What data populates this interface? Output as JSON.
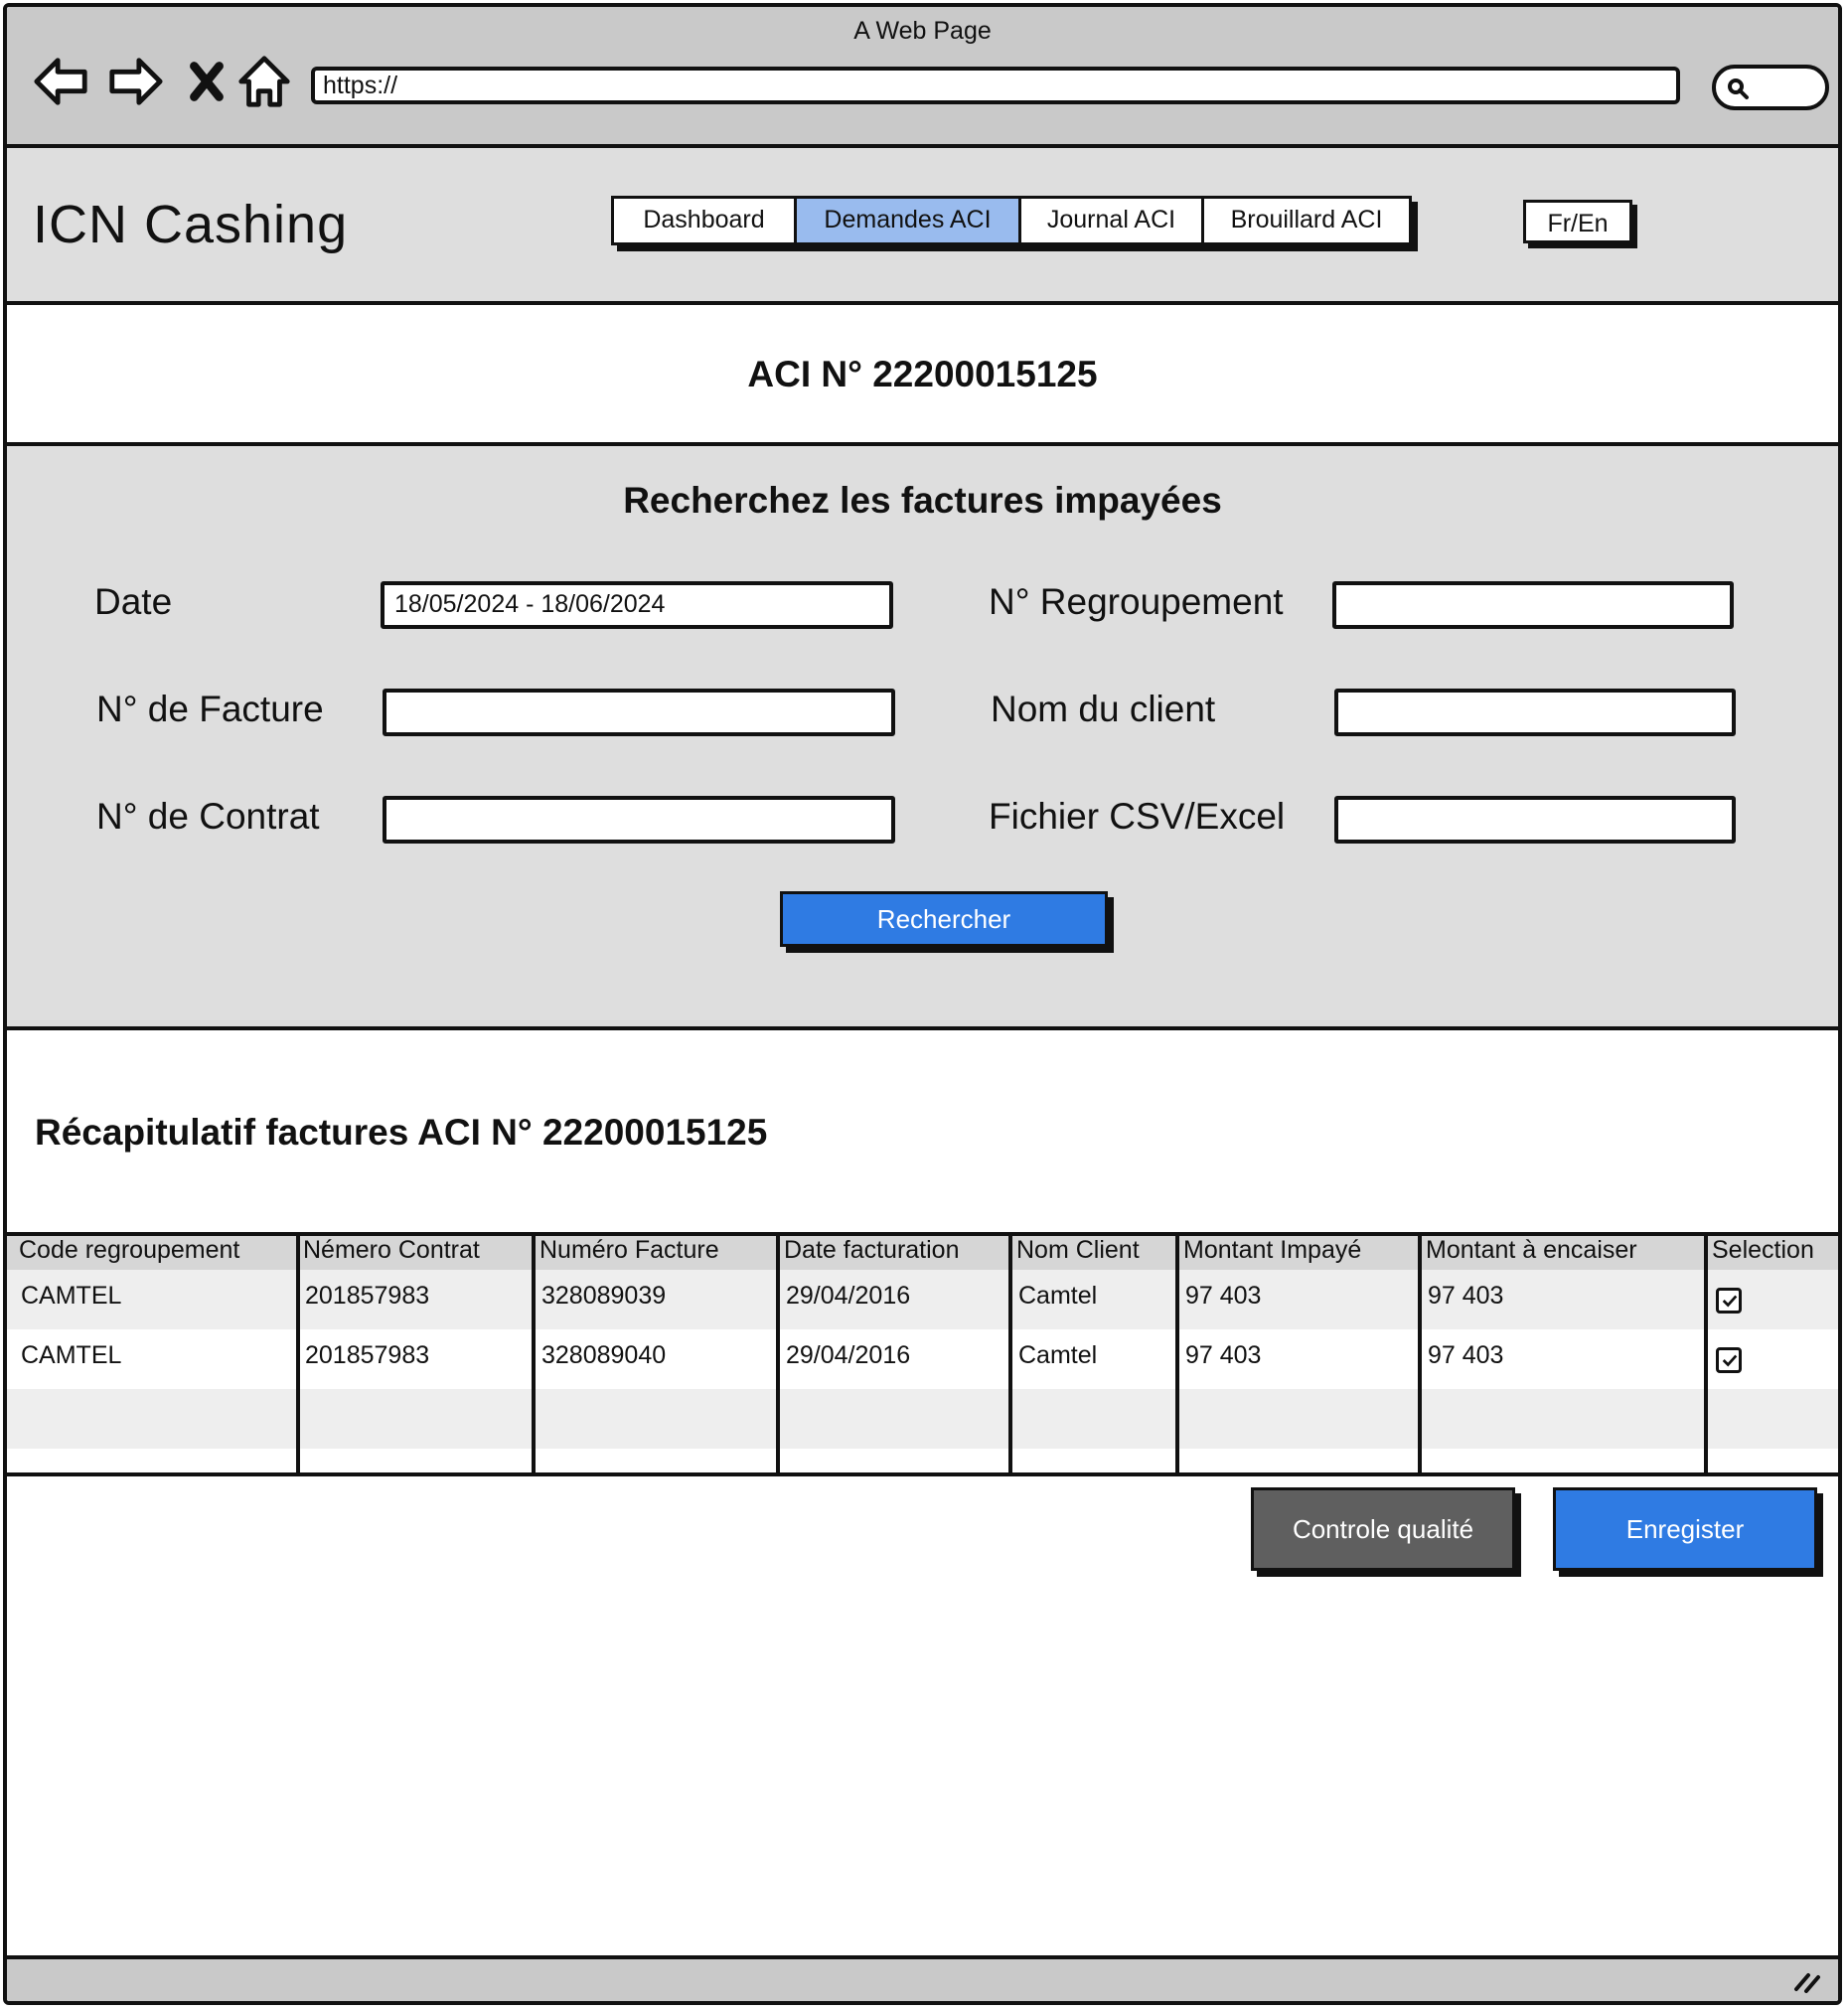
{
  "browser": {
    "window_title": "A Web Page",
    "url": "https://",
    "icons": [
      "back-arrow-icon",
      "forward-arrow-icon",
      "close-x-icon",
      "home-icon",
      "search-icon"
    ]
  },
  "header": {
    "app_name": "ICN Cashing",
    "tabs": [
      {
        "label": "Dashboard",
        "active": false
      },
      {
        "label": "Demandes ACI",
        "active": true
      },
      {
        "label": "Journal ACI",
        "active": false
      },
      {
        "label": "Brouillard ACI",
        "active": false
      }
    ],
    "lang_toggle": "Fr/En"
  },
  "aci": {
    "title": "ACI N° 22200015125"
  },
  "search": {
    "title": "Recherchez les factures impayées",
    "fields": {
      "date": {
        "label": "Date",
        "value": "18/05/2024 -  18/06/2024"
      },
      "regroupement": {
        "label": "N° Regroupement",
        "value": ""
      },
      "facture": {
        "label": "N° de Facture",
        "value": ""
      },
      "client": {
        "label": "Nom du client",
        "value": ""
      },
      "contrat": {
        "label": "N° de Contrat",
        "value": ""
      },
      "fichier": {
        "label": "Fichier CSV/Excel",
        "value": ""
      }
    },
    "button": "Rechercher"
  },
  "recap": {
    "title": "Récapitulatif factures ACI N° 22200015125",
    "columns": [
      "Code regroupement",
      "Némero Contrat",
      "Numéro Facture",
      "Date facturation",
      "Nom Client",
      "Montant Impayé",
      "Montant à encaiser",
      "Selection"
    ],
    "rows": [
      {
        "code": "CAMTEL",
        "contrat": "201857983",
        "facture": "328089039",
        "date": "29/04/2016",
        "client": "Camtel",
        "impaye": "97 403",
        "encaisser": "97 403",
        "selected": true
      },
      {
        "code": "CAMTEL",
        "contrat": "201857983",
        "facture": "328089040",
        "date": "29/04/2016",
        "client": "Camtel",
        "impaye": "97 403",
        "encaisser": "97 403",
        "selected": true
      }
    ]
  },
  "actions": {
    "quality": "Controle qualité",
    "save": "Enregister"
  },
  "colors": {
    "primary": "#2f7be3",
    "active_tab": "#99bbee",
    "secondary_button": "#5f5f5f",
    "panel": "#dedede",
    "chrome": "#c9c9c9"
  }
}
